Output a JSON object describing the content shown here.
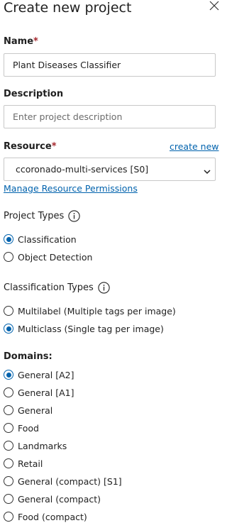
{
  "title": "Create new project",
  "close_icon": "close-icon",
  "name": {
    "label": "Name",
    "required_mark": "*",
    "value": "Plant Diseases Classifier"
  },
  "description": {
    "label": "Description",
    "placeholder": "Enter project description",
    "value": ""
  },
  "resource": {
    "label": "Resource",
    "required_mark": "*",
    "create_new": "create new",
    "selected": "ccoronado-multi-services [S0]",
    "manage_permissions": "Manage Resource Permissions"
  },
  "project_types": {
    "label": "Project Types",
    "info_icon": "info-icon",
    "options": [
      {
        "label": "Classification",
        "checked": true
      },
      {
        "label": "Object Detection",
        "checked": false
      }
    ]
  },
  "classification_types": {
    "label": "Classification Types",
    "info_icon": "info-icon",
    "options": [
      {
        "label": "Multilabel (Multiple tags per image)",
        "checked": false
      },
      {
        "label": "Multiclass (Single tag per image)",
        "checked": true
      }
    ]
  },
  "domains": {
    "label": "Domains:",
    "options": [
      {
        "label": "General [A2]",
        "checked": true
      },
      {
        "label": "General [A1]",
        "checked": false
      },
      {
        "label": "General",
        "checked": false
      },
      {
        "label": "Food",
        "checked": false
      },
      {
        "label": "Landmarks",
        "checked": false
      },
      {
        "label": "Retail",
        "checked": false
      },
      {
        "label": "General (compact) [S1]",
        "checked": false
      },
      {
        "label": "General (compact)",
        "checked": false
      },
      {
        "label": "Food (compact)",
        "checked": false
      }
    ]
  },
  "colors": {
    "accent": "#0062ad",
    "required": "#a4262c",
    "border": "#c8c8c8"
  }
}
